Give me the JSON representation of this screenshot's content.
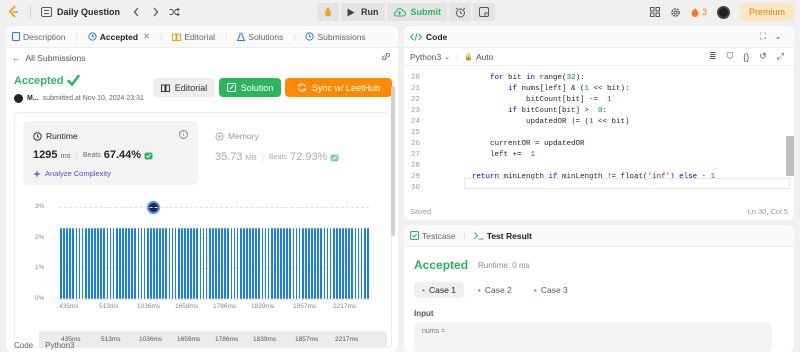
{
  "topbar": {
    "title": "Daily Question",
    "run": "Run",
    "submit": "Submit",
    "streak": "3",
    "premium": "Premium"
  },
  "left_tabs": [
    "Description",
    "Accepted",
    "Editorial",
    "Solutions",
    "Submissions"
  ],
  "back_label": "All Submissions",
  "status": "Accepted",
  "user": "M...",
  "submitted": "submitted at Nov 10, 2024 23:31",
  "buttons": {
    "editorial": "Editorial",
    "solution": "Solution",
    "sync": "Sync w/ LeetHub"
  },
  "runtime": {
    "label": "Runtime",
    "value": "1295",
    "unit": "ms",
    "beats_label": "Beats",
    "beats": "67.44%",
    "analyze": "Analyze Complexity"
  },
  "memory": {
    "label": "Memory",
    "value": "35.73",
    "unit": "MB",
    "beats_label": "Beats",
    "beats": "72.93%"
  },
  "chart_data": {
    "type": "bar",
    "y_ticks": [
      "3%",
      "2%",
      "1%",
      "0%"
    ],
    "ylim": [
      0,
      3
    ],
    "x_ticks": [
      "435ms",
      "513ms",
      "1036ms",
      "1659ms",
      "1786ms",
      "1839ms",
      "1857ms",
      "2217ms"
    ],
    "values": [
      2.3,
      2.3,
      2.3,
      2.3,
      2.3,
      2.3,
      2.3,
      2.3,
      2.3,
      2.3,
      2.3,
      2.3,
      2.3,
      2.3,
      2.3,
      2.3,
      2.3,
      2.3,
      2.3,
      2.3,
      2.3,
      2.3,
      2.3,
      2.3,
      2.3,
      2.3,
      2.3,
      2.3,
      2.3,
      2.3,
      2.3,
      2.3,
      2.3,
      2.3,
      2.3,
      2.3,
      2.3,
      2.3,
      2.3,
      2.3,
      2.3,
      2.3,
      2.3,
      2.3,
      2.3,
      2.3,
      2.3,
      2.3,
      2.3,
      2.3,
      2.3,
      2.3,
      2.3,
      2.3,
      2.3,
      2.3,
      2.3,
      2.3,
      2.3,
      2.3,
      2.3,
      2.3,
      2.3,
      2.3,
      2.3,
      2.3,
      2.3,
      2.3,
      2.3,
      2.3,
      2.3,
      2.3,
      2.3,
      2.3,
      2.3,
      2.3,
      2.3,
      2.3,
      2.3,
      2.3,
      2.3,
      2.3,
      2.3,
      2.3,
      2.3,
      2.3,
      2.3,
      2.3,
      2.3,
      2.3,
      2.3,
      2.3,
      2.3,
      2.3,
      2.3,
      2.3,
      2.3,
      2.3,
      2.3,
      2.3
    ]
  },
  "left_footer": [
    "Code",
    "Python3"
  ],
  "code_panel": {
    "title": "Code",
    "language": "Python3",
    "mode": "Auto",
    "saved": "Saved",
    "cursor": "Ln 30, Col 5",
    "lines": [
      {
        "n": "20",
        "indent": 8,
        "tokens": [
          [
            "kw",
            "for"
          ],
          [
            "",
            "bit"
          ],
          [
            "kw",
            "in"
          ],
          [
            "",
            "range("
          ],
          [
            "num",
            "32"
          ],
          [
            "",
            "):"
          ]
        ]
      },
      {
        "n": "21",
        "indent": 12,
        "tokens": [
          [
            "kw",
            "if"
          ],
          [
            "",
            "nums[left] & ("
          ],
          [
            "num",
            "1"
          ],
          [
            "",
            "<< bit):"
          ]
        ]
      },
      {
        "n": "22",
        "indent": 16,
        "tokens": [
          [
            "",
            "bitCount[bit] -= "
          ],
          [
            "num",
            "1"
          ]
        ]
      },
      {
        "n": "23",
        "indent": 12,
        "tokens": [
          [
            "kw",
            "if"
          ],
          [
            "",
            "bitCount[bit] > "
          ],
          [
            "num",
            "0"
          ],
          [
            "",
            ":"
          ]
        ]
      },
      {
        "n": "24",
        "indent": 16,
        "tokens": [
          [
            "",
            "updatedOR |= ("
          ],
          [
            "num",
            "1"
          ],
          [
            "",
            "<< bit)"
          ]
        ]
      },
      {
        "n": "25",
        "indent": 0,
        "tokens": []
      },
      {
        "n": "26",
        "indent": 8,
        "tokens": [
          [
            "",
            "currentOR = updatedOR"
          ]
        ]
      },
      {
        "n": "27",
        "indent": 8,
        "tokens": [
          [
            "",
            "left += "
          ],
          [
            "num",
            "1"
          ]
        ]
      },
      {
        "n": "28",
        "indent": 0,
        "tokens": []
      },
      {
        "n": "29",
        "indent": 4,
        "tokens": [
          [
            "kw",
            "return"
          ],
          [
            "",
            "minLength"
          ],
          [
            "kw",
            "if"
          ],
          [
            "",
            "minLength != float("
          ],
          [
            "str",
            "'inf'"
          ],
          [
            "",
            ")"
          ],
          [
            "kw",
            "else"
          ],
          [
            "",
            "-"
          ],
          [
            "num",
            "1"
          ]
        ]
      },
      {
        "n": "30",
        "indent": 0,
        "tokens": []
      }
    ]
  },
  "bottom_panel": {
    "tabs": [
      "Testcase",
      "Test Result"
    ],
    "status": "Accepted",
    "runtime": "Runtime: 0 ms",
    "cases": [
      "Case 1",
      "Case 2",
      "Case 3"
    ],
    "input_label": "Input",
    "var_label": "nums ="
  },
  "colors": {
    "accent_green": "#2db55d",
    "accent_blue": "#1a7cf5",
    "sync_orange": "#ff8a00"
  }
}
